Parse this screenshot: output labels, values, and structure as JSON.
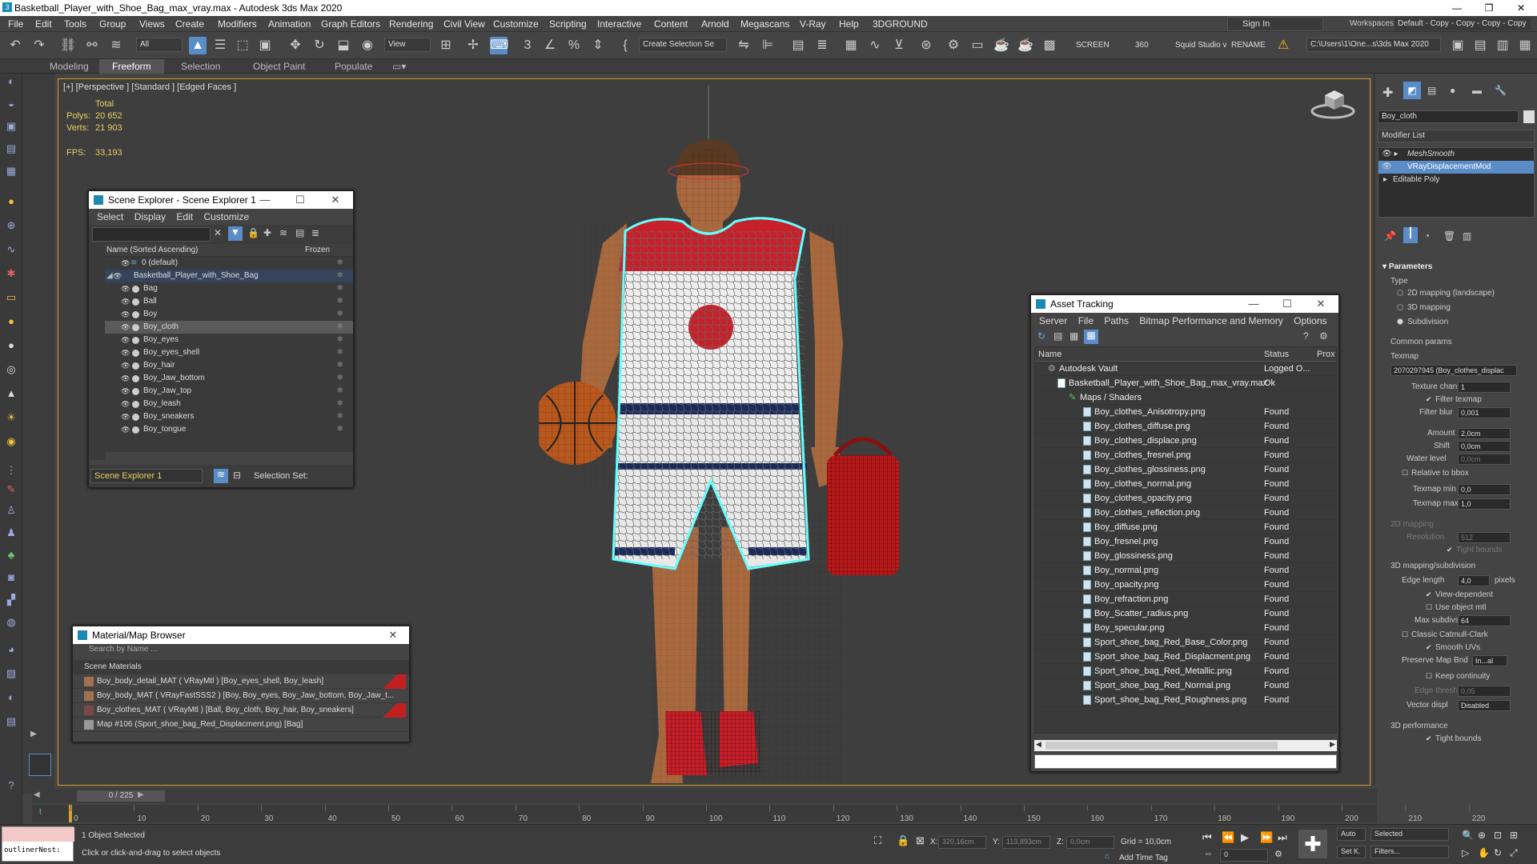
{
  "window": {
    "title": "Basketball_Player_with_Shoe_Bag_max_vray.max - Autodesk 3ds Max 2020"
  },
  "menu": {
    "items": [
      "File",
      "Edit",
      "Tools",
      "Group",
      "Views",
      "Create",
      "Modifiers",
      "Animation",
      "Graph Editors",
      "Rendering",
      "Civil View",
      "Customize",
      "Scripting",
      "Interactive",
      "Content",
      "Arnold",
      "Megascans",
      "V-Ray",
      "Help",
      "3DGROUND"
    ],
    "signin": "Sign In",
    "workspaces_label": "Workspaces:",
    "workspace_value": "Default - Copy - Copy - Copy - Copy"
  },
  "toolbar": {
    "filter": "All",
    "refcoord": "View",
    "named_sel": "Create Selection Se",
    "screen": "SCREEN",
    "num360": "360",
    "squid": "Squid Studio v",
    "rename": "RENAME",
    "path": "C:\\Users\\1\\One...s\\3ds Max 2020"
  },
  "ribbon": {
    "tabs": [
      "Modeling",
      "Freeform",
      "Selection",
      "Object Paint",
      "Populate"
    ],
    "active": "Freeform"
  },
  "viewport": {
    "label": "[+] [Perspective ] [Standard ] [Edged Faces ]",
    "total": "Total",
    "polys_label": "Polys:",
    "polys": "20 652",
    "verts_label": "Verts:",
    "verts": "21 903",
    "fps_label": "FPS:",
    "fps": "33,193"
  },
  "scene_explorer": {
    "title": "Scene Explorer - Scene Explorer 1",
    "menu": [
      "Select",
      "Display",
      "Edit",
      "Customize"
    ],
    "col_name": "Name (Sorted Ascending)",
    "col_frozen": "Frozen",
    "layer": "0 (default)",
    "parent": "Basketball_Player_with_Shoe_Bag",
    "items": [
      "Bag",
      "Ball",
      "Boy",
      "Boy_cloth",
      "Boy_eyes",
      "Boy_eyes_shell",
      "Boy_hair",
      "Boy_Jaw_bottom",
      "Boy_Jaw_top",
      "Boy_leash",
      "Boy_sneakers",
      "Boy_tongue"
    ],
    "selected": "Boy_cloth",
    "explorer_name": "Scene Explorer 1",
    "selection_set": "Selection Set:"
  },
  "material_browser": {
    "title": "Material/Map Browser",
    "search": "Search by Name ...",
    "group": "Scene Materials",
    "items": [
      "Boy_body_detail_MAT  ( VRayMtl ) [Boy_eyes_shell, Boy_leash]",
      "Boy_body_MAT  ( VRayFastSSS2 ) [Boy, Boy_eyes, Boy_Jaw_bottom, Boy_Jaw_t...",
      "Boy_clothes_MAT  ( VRayMtl ) [Ball, Boy_cloth, Boy_hair, Boy_sneakers]",
      "Map #106 (Sport_shoe_bag_Red_Displacment.png) [Bag]"
    ]
  },
  "asset_tracking": {
    "title": "Asset Tracking",
    "menu": [
      "Server",
      "File",
      "Paths",
      "Bitmap Performance and Memory",
      "Options"
    ],
    "col_name": "Name",
    "col_status": "Status",
    "col_proxy": "Prox",
    "vault": "Autodesk Vault",
    "vault_status": "Logged O...",
    "file": "Basketball_Player_with_Shoe_Bag_max_vray.max",
    "file_status": "Ok",
    "maps": "Maps / Shaders",
    "found": "Found",
    "assets": [
      "Boy_clothes_Anisotropy.png",
      "Boy_clothes_diffuse.png",
      "Boy_clothes_displace.png",
      "Boy_clothes_fresnel.png",
      "Boy_clothes_glossiness.png",
      "Boy_clothes_normal.png",
      "Boy_clothes_opacity.png",
      "Boy_clothes_reflection.png",
      "Boy_diffuse.png",
      "Boy_fresnel.png",
      "Boy_glossiness.png",
      "Boy_normal.png",
      "Boy_opacity.png",
      "Boy_refraction.png",
      "Boy_Scatter_radius.png",
      "Boy_specular.png",
      "Sport_shoe_bag_Red_Base_Color.png",
      "Sport_shoe_bag_Red_Displacment.png",
      "Sport_shoe_bag_Red_Metallic.png",
      "Sport_shoe_bag_Red_Normal.png",
      "Sport_shoe_bag_Red_Roughness.png"
    ]
  },
  "command_panel": {
    "object_name": "Boy_cloth",
    "modifier_list": "Modifier List",
    "stack": [
      "MeshSmooth",
      "VRayDisplacementMod",
      "Editable Poly"
    ],
    "stack_selected": "VRayDisplacementMod",
    "parameters": "Parameters",
    "type_label": "Type",
    "type_options": [
      "2D mapping (landscape)",
      "3D mapping",
      "Subdivision"
    ],
    "type_selected": "Subdivision",
    "common_params": "Common params",
    "texmap_label": "Texmap",
    "texmap_value": "2070297945 (Boy_clothes_displac",
    "texture_chan_label": "Texture chan",
    "texture_chan": "1",
    "filter_texmap": "Filter texmap",
    "filter_blur_label": "Filter blur",
    "filter_blur": "0,001",
    "amount_label": "Amount",
    "amount": "2,0cm",
    "shift_label": "Shift",
    "shift": "0,0cm",
    "water_label": "Water level",
    "water": "0,0cm",
    "relative_bbox": "Relative to bbox",
    "texmap_min_label": "Texmap min",
    "texmap_min": "0,0",
    "texmap_max_label": "Texmap max",
    "texmap_max": "1,0",
    "mapping2d": "2D mapping",
    "resolution_label": "Resolution",
    "resolution": "512",
    "tight_bounds": "Tight bounds",
    "mapping3d": "3D mapping/subdivision",
    "edge_length_label": "Edge length",
    "edge_length": "4,0",
    "pixels": "pixels",
    "view_dependent": "View-dependent",
    "use_object_mtl": "Use object mtl",
    "max_subdivs_label": "Max subdivs",
    "max_subdivs": "64",
    "classic_catmull": "Classic Catmull-Clark",
    "smooth_uvs": "Smooth UVs",
    "preserve_label": "Preserve Map Bnd",
    "preserve": "In...al",
    "keep_continuity": "Keep continuity",
    "edge_thresh_label": "Edge thresh",
    "edge_thresh": "0,05",
    "vector_displ_label": "Vector displ",
    "vector_displ": "Disabled",
    "perf3d": "3D performance",
    "tight_bounds2": "Tight bounds"
  },
  "timeline": {
    "frame": "0 / 225",
    "ticks": [
      "0",
      "10",
      "20",
      "30",
      "40",
      "50",
      "60",
      "70",
      "80",
      "90",
      "100",
      "110",
      "120",
      "130",
      "140",
      "150",
      "160",
      "170",
      "180",
      "190",
      "200",
      "210",
      "220"
    ]
  },
  "status": {
    "maxscript": "outlinerNest:",
    "selected": "1 Object Selected",
    "hint": "Click or click-and-drag to select objects",
    "x_label": "X:",
    "x": "320,16cm",
    "y_label": "Y:",
    "y": "113,893cm",
    "z_label": "Z:",
    "z": "0,0cm",
    "grid": "Grid = 10,0cm",
    "add_time_tag": "Add Time Tag",
    "auto": "Auto",
    "selected_dd": "Selected",
    "setk": "Set K.",
    "filters": "Filters...",
    "frame_box": "0"
  },
  "colors": {
    "accent": "#5a8dc8",
    "viewport_border": "#d8a020",
    "stats": "#e8d060"
  }
}
